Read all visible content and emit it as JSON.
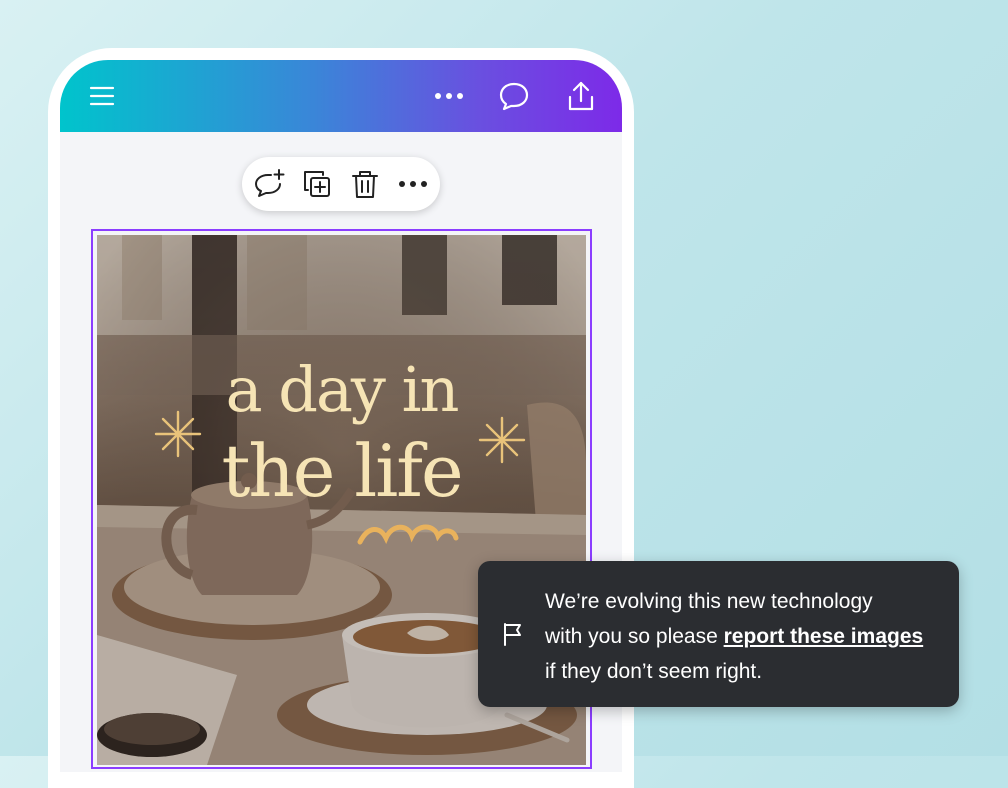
{
  "topbar": {
    "gradient_start": "#00c4cc",
    "gradient_end": "#7d2ae8",
    "icons": [
      "hamburger-menu-icon",
      "more-options-icon",
      "comment-icon",
      "share-icon"
    ]
  },
  "element_toolbar": {
    "icons": [
      "add-comment-icon",
      "duplicate-icon",
      "delete-icon",
      "more-options-icon"
    ]
  },
  "design": {
    "title_line1": "a day in",
    "title_line2": "the life",
    "accent_color": "#f6e4b5",
    "selection_color": "#8b3dff"
  },
  "notice": {
    "text_line1": "We’re evolving this new technology",
    "text_line2_prefix": "with you so please ",
    "link_text": "report these images",
    "text_line3": "if they don’t seem right.",
    "icon": "flag-icon"
  }
}
